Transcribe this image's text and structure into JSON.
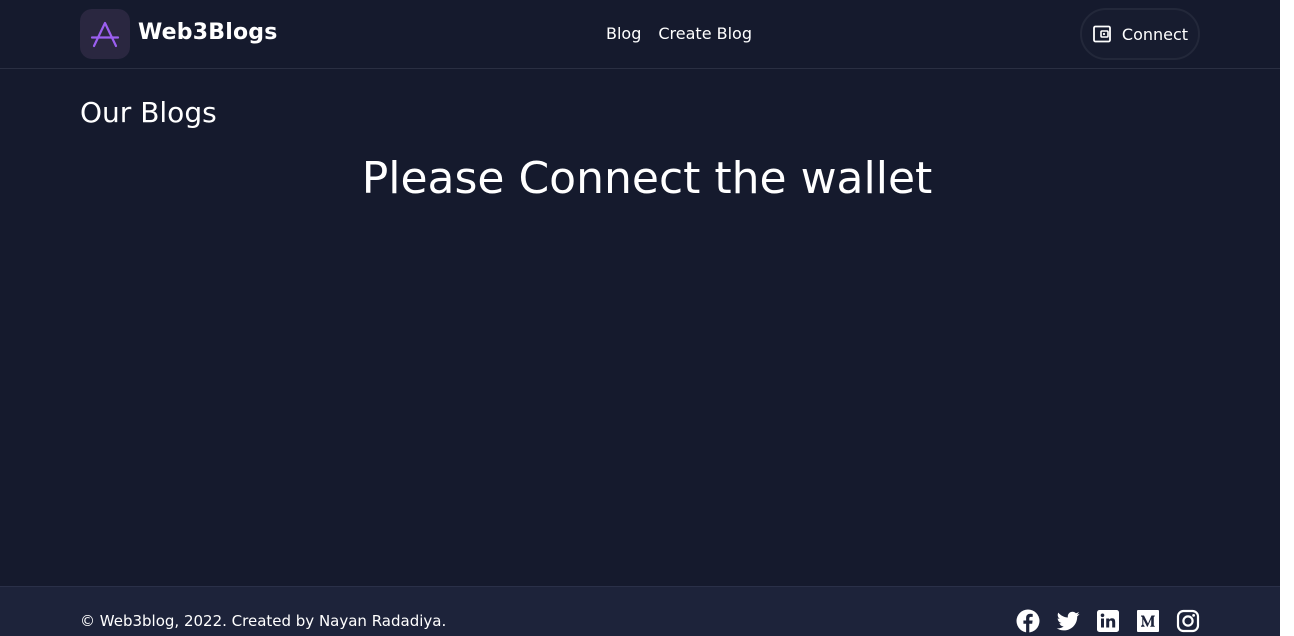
{
  "header": {
    "brand_name": "Web3Blogs",
    "nav": [
      {
        "label": "Blog"
      },
      {
        "label": "Create Blog"
      }
    ],
    "connect_label": "Connect"
  },
  "main": {
    "section_title": "Our Blogs",
    "empty_message": "Please Connect the wallet"
  },
  "footer": {
    "copyright": "© Web3blog, 2022. Created by Nayan Radadiya.",
    "social_icons": [
      "facebook-icon",
      "twitter-icon",
      "linkedin-icon",
      "medium-icon",
      "instagram-icon"
    ]
  },
  "colors": {
    "background": "#151a2d",
    "footer_background": "#1d233a",
    "logo_accent": "#9b5ff0",
    "text": "#ffffff"
  }
}
